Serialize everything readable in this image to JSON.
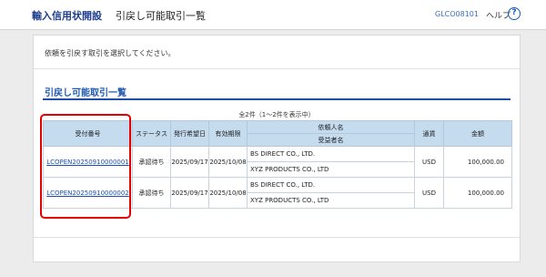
{
  "header": {
    "app_title": "輸入信用状開設",
    "page_title": "引戻し可能取引一覧",
    "screen_id": "GLCO08101",
    "help_label": "ヘルプ",
    "help_icon": "?"
  },
  "main": {
    "instruction": "依頼を引戻す取引を選択してください。",
    "section_title": "引戻し可能取引一覧",
    "count_text": "全2件（1〜2件を表示中）",
    "table": {
      "headers": {
        "receipt_no": "受付番号",
        "status": "ステータス",
        "issue_date": "発行希望日",
        "expiry": "有効期限",
        "applicant": "依頼人名",
        "beneficiary": "受益者名",
        "currency": "通貨",
        "amount": "金額"
      },
      "rows": [
        {
          "receipt_no": "LCOPEN20250910000001",
          "status": "承認待ち",
          "issue_date": "2025/09/17",
          "expiry": "2025/10/08",
          "applicant": "BS DIRECT CO., LTD.",
          "beneficiary": "XYZ PRODUCTS CO., LTD",
          "currency": "USD",
          "amount": "100,000.00"
        },
        {
          "receipt_no": "LCOPEN20250910000002",
          "status": "承認待ち",
          "issue_date": "2025/09/17",
          "expiry": "2025/10/08",
          "applicant": "BS DIRECT CO., LTD.",
          "beneficiary": "XYZ PRODUCTS CO., LTD",
          "currency": "USD",
          "amount": "100,000.00"
        }
      ]
    }
  },
  "colors": {
    "brand": "#1f3f8f",
    "accent": "#1f58b0",
    "header_cell": "#c5dcef",
    "highlight": "#e60000"
  }
}
